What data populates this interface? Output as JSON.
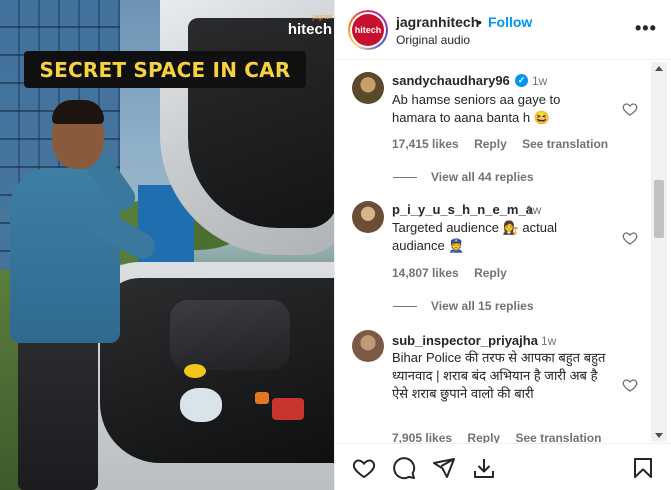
{
  "media": {
    "caption": "SECRET SPACE IN CAR",
    "watermark_small": "jagran",
    "watermark_big": "hitech"
  },
  "header": {
    "username": "jagranhitech",
    "separator": "•",
    "follow_label": "Follow",
    "subtitle": "Original audio",
    "avatar_text": "hitech",
    "more_icon": "more-horizontal-icon"
  },
  "comments": [
    {
      "username": "sandychaudhary96",
      "verified": true,
      "time": "1w",
      "text": "Ab hamse seniors aa gaye to hamara to aana banta h 😆",
      "likes": "17,415 likes",
      "reply_label": "Reply",
      "translate_label": "See translation",
      "view_replies": "View all 44 replies"
    },
    {
      "username": "p_i_y_u_s_h_n_e_m_a",
      "verified": false,
      "time": "1w",
      "text": "Targeted audience 👩‍⚖️ actual audiance 👮",
      "likes": "14,807 likes",
      "reply_label": "Reply",
      "view_replies": "View all 15 replies"
    },
    {
      "username": "sub_inspector_priyajha",
      "verified": false,
      "time": "1w",
      "text": "Bihar Police की तरफ से आपका बहुत बहुत ध्यानवाद | शराब बंद अभियान है जारी अब है ऐसे शराब छुपाने वालो की बारी",
      "likes": "7,905 likes",
      "reply_label": "Reply",
      "translate_label": "See translation"
    }
  ],
  "actions": {
    "like_icon": "heart-icon",
    "comment_icon": "comment-icon",
    "share_icon": "share-icon",
    "download_icon": "download-icon",
    "save_icon": "bookmark-icon"
  },
  "colors": {
    "accent": "#0095f6",
    "caption_text": "#f6d23f",
    "secondary_text": "#737373"
  }
}
